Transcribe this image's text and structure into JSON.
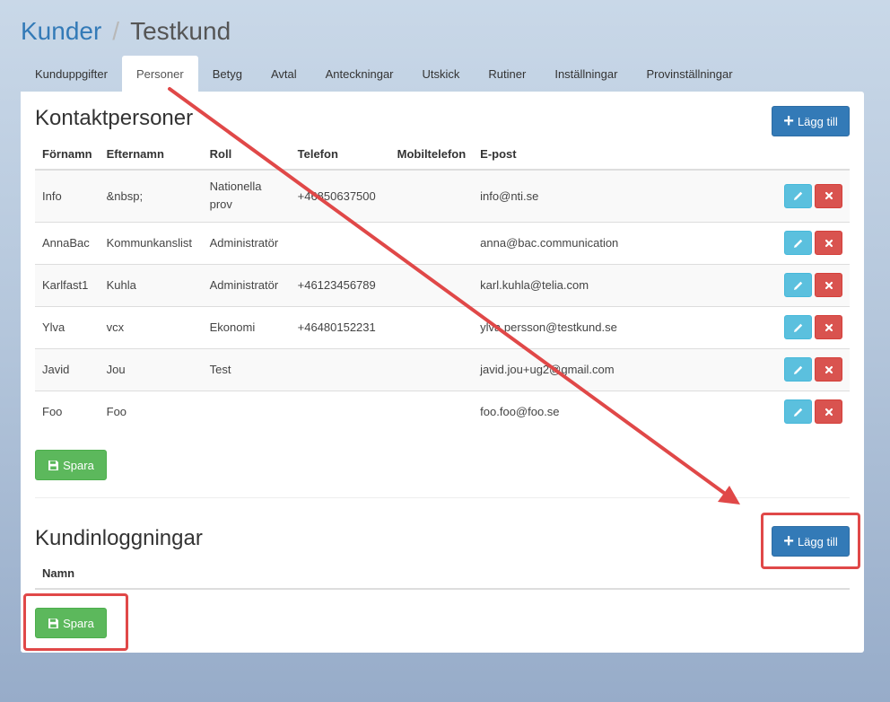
{
  "breadcrumb": {
    "parent": "Kunder",
    "separator": "/",
    "current": "Testkund"
  },
  "tabs": [
    {
      "label": "Kunduppgifter"
    },
    {
      "label": "Personer"
    },
    {
      "label": "Betyg"
    },
    {
      "label": "Avtal"
    },
    {
      "label": "Anteckningar"
    },
    {
      "label": "Utskick"
    },
    {
      "label": "Rutiner"
    },
    {
      "label": "Inställningar"
    },
    {
      "label": "Provinställningar"
    }
  ],
  "active_tab": "Personer",
  "contacts": {
    "title": "Kontaktpersoner",
    "add_label": "Lägg till",
    "columns": [
      "Förnamn",
      "Efternamn",
      "Roll",
      "Telefon",
      "Mobiltelefon",
      "E-post"
    ],
    "rows": [
      [
        "Info",
        "&nbsp;",
        "Nationella prov",
        "+46850637500",
        "",
        "info@nti.se"
      ],
      [
        "AnnaBac",
        "Kommunkanslist",
        "Administratör",
        "",
        "",
        "anna@bac.communication"
      ],
      [
        "Karlfast1",
        "Kuhla",
        "Administratör",
        "+46123456789",
        "",
        "karl.kuhla@telia.com"
      ],
      [
        "Ylva",
        "vcx",
        "Ekonomi",
        "+46480152231",
        "",
        "ylva.persson@testkund.se"
      ],
      [
        "Javid",
        "Jou",
        "Test",
        "",
        "",
        "javid.jou+ug2@gmail.com"
      ],
      [
        "Foo",
        "Foo",
        "",
        "",
        "",
        "foo.foo@foo.se"
      ]
    ],
    "save_label": "Spara"
  },
  "logins": {
    "title": "Kundinloggningar",
    "add_label": "Lägg till",
    "columns": [
      "Namn"
    ],
    "save_label": "Spara"
  },
  "icons": {
    "plus": "plus-icon",
    "save": "floppy-disk-icon",
    "edit": "pencil-icon",
    "delete": "close-icon"
  },
  "colors": {
    "primary": "#337ab7",
    "success": "#5cb85c",
    "info": "#5bc0de",
    "danger": "#d9534f",
    "annotation": "#e04848"
  }
}
